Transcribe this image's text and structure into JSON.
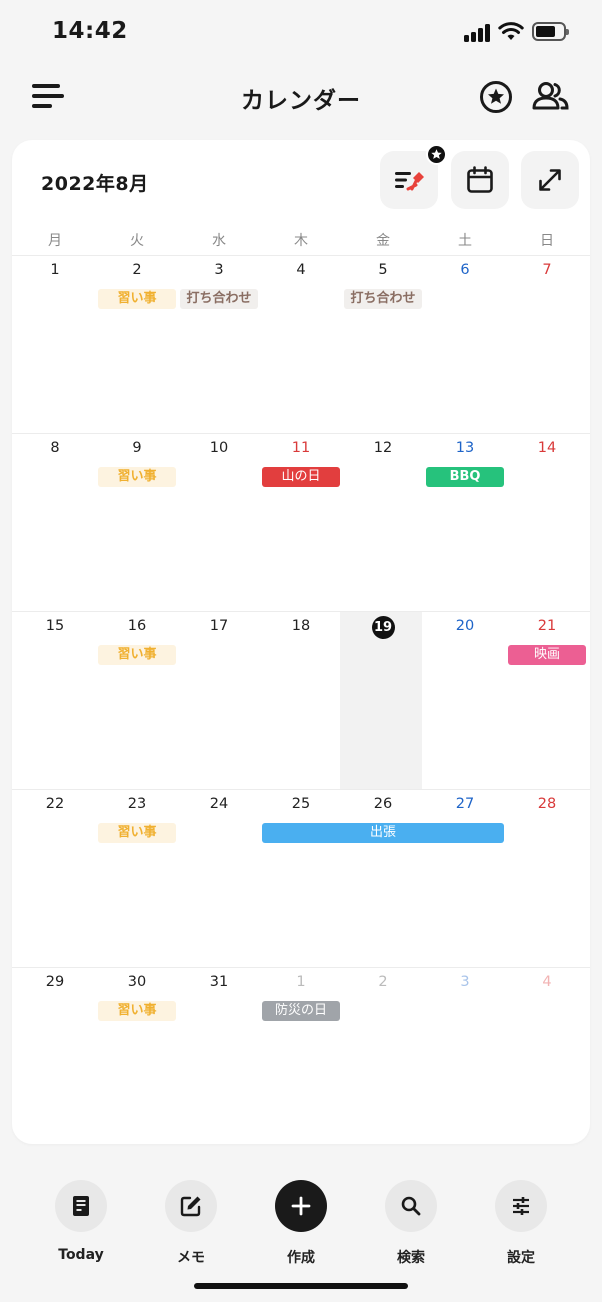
{
  "status": {
    "time": "14:42"
  },
  "header": {
    "title": "カレンダー"
  },
  "calendar": {
    "month_title": "2022年8月",
    "weekdays": [
      "月",
      "火",
      "水",
      "木",
      "金",
      "土",
      "日"
    ],
    "weeks": [
      {
        "days": [
          "1",
          "2",
          "3",
          "4",
          "5",
          "6",
          "7"
        ],
        "events": [
          {
            "label": "習い事",
            "start": 1,
            "span": 1,
            "style": "lesson"
          },
          {
            "label": "打ち合わせ",
            "start": 2,
            "span": 1,
            "style": "meeting"
          },
          {
            "label": "打ち合わせ",
            "start": 4,
            "span": 1,
            "style": "meeting"
          }
        ]
      },
      {
        "days": [
          "8",
          "9",
          "10",
          "11",
          "12",
          "13",
          "14"
        ],
        "holiday_index": 3,
        "events": [
          {
            "label": "習い事",
            "start": 1,
            "span": 1,
            "style": "lesson"
          },
          {
            "label": "山の日",
            "start": 3,
            "span": 1,
            "style": "red"
          },
          {
            "label": "BBQ",
            "start": 5,
            "span": 1,
            "style": "green"
          }
        ]
      },
      {
        "days": [
          "15",
          "16",
          "17",
          "18",
          "19",
          "20",
          "21"
        ],
        "today_index": 4,
        "events": [
          {
            "label": "習い事",
            "start": 1,
            "span": 1,
            "style": "lesson"
          },
          {
            "label": "映画",
            "start": 6,
            "span": 1,
            "style": "pink"
          }
        ]
      },
      {
        "days": [
          "22",
          "23",
          "24",
          "25",
          "26",
          "27",
          "28"
        ],
        "events": [
          {
            "label": "習い事",
            "start": 1,
            "span": 1,
            "style": "lesson"
          },
          {
            "label": "出張",
            "start": 3,
            "span": 3,
            "style": "blue"
          }
        ]
      },
      {
        "days": [
          "29",
          "30",
          "31",
          "1",
          "2",
          "3",
          "4"
        ],
        "dim_from": 3,
        "events": [
          {
            "label": "習い事",
            "start": 1,
            "span": 1,
            "style": "lesson"
          },
          {
            "label": "防災の日",
            "start": 3,
            "span": 1,
            "style": "gray"
          }
        ]
      }
    ]
  },
  "tabs": [
    {
      "label": "Today",
      "icon": "today-icon"
    },
    {
      "label": "メモ",
      "icon": "memo-edit-icon"
    },
    {
      "label": "作成",
      "icon": "plus-icon"
    },
    {
      "label": "検索",
      "icon": "search-icon"
    },
    {
      "label": "設定",
      "icon": "settings-sliders-icon"
    }
  ],
  "colors": {
    "saturday": "#1e64c8",
    "sunday_holiday": "#d93a3a",
    "lesson": "#f0b030",
    "holiday_event": "#e23e3e",
    "bbq": "#26c27c",
    "movie": "#ec5f93",
    "trip": "#4aaff0",
    "disaster_day": "#a0a4a9"
  }
}
